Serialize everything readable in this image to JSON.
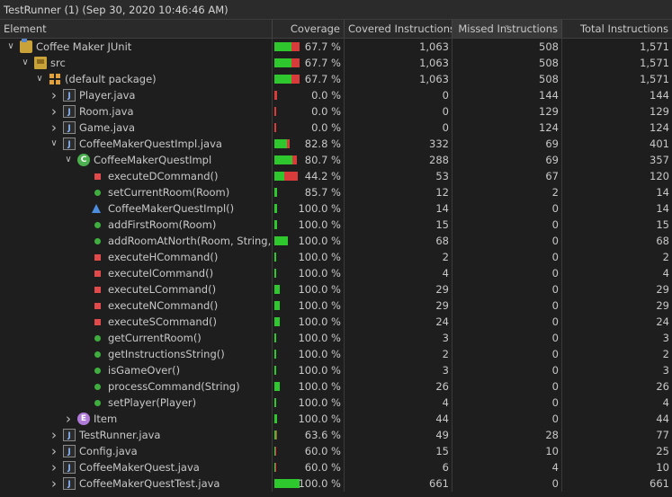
{
  "title": "TestRunner (1) (Sep 30, 2020 10:46:46 AM)",
  "columns": {
    "element": "Element",
    "coverage": "Coverage",
    "covered": "Covered Instructions",
    "missed": "Missed Instructions",
    "total": "Total Instructions"
  },
  "colors": {
    "covered": "#2ec72e",
    "missed": "#d93b3b",
    "selected": "#2d3d52"
  },
  "rows": [
    {
      "name": "Coffee Maker JUnit",
      "depth": 0,
      "twisty": "open",
      "icon": "project-icon",
      "coverage": "67.7 %",
      "covered": "1,063",
      "missed": "508",
      "total": "1,571",
      "bar_total_fraction": 1.0,
      "bar_covered_fraction": 0.677
    },
    {
      "name": "src",
      "depth": 1,
      "twisty": "open",
      "icon": "source-folder-icon",
      "coverage": "67.7 %",
      "covered": "1,063",
      "missed": "508",
      "total": "1,571",
      "bar_total_fraction": 1.0,
      "bar_covered_fraction": 0.677
    },
    {
      "name": "(default package)",
      "depth": 2,
      "twisty": "open",
      "icon": "package-icon",
      "coverage": "67.7 %",
      "covered": "1,063",
      "missed": "508",
      "total": "1,571",
      "bar_total_fraction": 1.0,
      "bar_covered_fraction": 0.677
    },
    {
      "name": "Player.java",
      "depth": 3,
      "twisty": "closed",
      "icon": "java-file-icon",
      "coverage": "0.0 %",
      "covered": "0",
      "missed": "144",
      "total": "144",
      "bar_total_fraction": 0.09,
      "bar_covered_fraction": 0.0
    },
    {
      "name": "Room.java",
      "depth": 3,
      "twisty": "closed",
      "icon": "java-file-icon",
      "coverage": "0.0 %",
      "covered": "0",
      "missed": "129",
      "total": "129",
      "bar_total_fraction": 0.08,
      "bar_covered_fraction": 0.0
    },
    {
      "name": "Game.java",
      "depth": 3,
      "twisty": "closed",
      "icon": "java-file-icon",
      "coverage": "0.0 %",
      "covered": "0",
      "missed": "124",
      "total": "124",
      "bar_total_fraction": 0.08,
      "bar_covered_fraction": 0.0
    },
    {
      "name": "CoffeeMakerQuestImpl.java",
      "depth": 3,
      "twisty": "open",
      "icon": "java-file-icon",
      "coverage": "82.8 %",
      "covered": "332",
      "missed": "69",
      "total": "401",
      "bar_total_fraction": 0.6,
      "bar_covered_fraction": 0.828
    },
    {
      "name": "CoffeeMakerQuestImpl",
      "depth": 4,
      "twisty": "open",
      "icon": "class-icon",
      "coverage": "80.7 %",
      "covered": "288",
      "missed": "69",
      "total": "357",
      "bar_total_fraction": 0.9,
      "bar_covered_fraction": 0.807
    },
    {
      "name": "executeDCommand()",
      "depth": 5,
      "twisty": "none",
      "icon": "private-method-icon",
      "coverage": "44.2 %",
      "covered": "53",
      "missed": "67",
      "total": "120",
      "bar_total_fraction": 0.92,
      "bar_covered_fraction": 0.442
    },
    {
      "name": "setCurrentRoom(Room)",
      "depth": 5,
      "twisty": "none",
      "icon": "public-method-icon",
      "coverage": "85.7 %",
      "covered": "12",
      "missed": "2",
      "total": "14",
      "bar_total_fraction": 0.1,
      "bar_covered_fraction": 0.857
    },
    {
      "name": "CoffeeMakerQuestImpl()",
      "depth": 5,
      "twisty": "none",
      "icon": "constructor-icon",
      "coverage": "100.0 %",
      "covered": "14",
      "missed": "0",
      "total": "14",
      "bar_total_fraction": 0.1,
      "bar_covered_fraction": 1.0
    },
    {
      "name": "addFirstRoom(Room)",
      "depth": 5,
      "twisty": "none",
      "icon": "public-method-icon",
      "coverage": "100.0 %",
      "covered": "15",
      "missed": "0",
      "total": "15",
      "bar_total_fraction": 0.1,
      "bar_covered_fraction": 1.0
    },
    {
      "name": "addRoomAtNorth(Room, String, S",
      "depth": 5,
      "twisty": "none",
      "icon": "public-method-icon",
      "coverage": "100.0 %",
      "covered": "68",
      "missed": "0",
      "total": "68",
      "bar_total_fraction": 0.55,
      "bar_covered_fraction": 1.0
    },
    {
      "name": "executeHCommand()",
      "depth": 5,
      "twisty": "none",
      "icon": "private-method-icon",
      "coverage": "100.0 %",
      "covered": "2",
      "missed": "0",
      "total": "2",
      "bar_total_fraction": 0.0,
      "bar_covered_fraction": 1.0
    },
    {
      "name": "executeICommand()",
      "depth": 5,
      "twisty": "none",
      "icon": "private-method-icon",
      "coverage": "100.0 %",
      "covered": "4",
      "missed": "0",
      "total": "4",
      "bar_total_fraction": 0.0,
      "bar_covered_fraction": 1.0
    },
    {
      "name": "executeLCommand()",
      "depth": 5,
      "twisty": "none",
      "icon": "private-method-icon",
      "coverage": "100.0 %",
      "covered": "29",
      "missed": "0",
      "total": "29",
      "bar_total_fraction": 0.22,
      "bar_covered_fraction": 1.0
    },
    {
      "name": "executeNCommand()",
      "depth": 5,
      "twisty": "none",
      "icon": "private-method-icon",
      "coverage": "100.0 %",
      "covered": "29",
      "missed": "0",
      "total": "29",
      "bar_total_fraction": 0.22,
      "bar_covered_fraction": 1.0
    },
    {
      "name": "executeSCommand()",
      "depth": 5,
      "twisty": "none",
      "icon": "private-method-icon",
      "coverage": "100.0 %",
      "covered": "24",
      "missed": "0",
      "total": "24",
      "bar_total_fraction": 0.2,
      "bar_covered_fraction": 1.0
    },
    {
      "name": "getCurrentRoom()",
      "depth": 5,
      "twisty": "none",
      "icon": "public-method-icon",
      "coverage": "100.0 %",
      "covered": "3",
      "missed": "0",
      "total": "3",
      "bar_total_fraction": 0.0,
      "bar_covered_fraction": 1.0
    },
    {
      "name": "getInstructionsString()",
      "depth": 5,
      "twisty": "none",
      "icon": "public-method-icon",
      "coverage": "100.0 %",
      "covered": "2",
      "missed": "0",
      "total": "2",
      "bar_total_fraction": 0.0,
      "bar_covered_fraction": 1.0
    },
    {
      "name": "isGameOver()",
      "depth": 5,
      "twisty": "none",
      "icon": "public-method-icon",
      "coverage": "100.0 %",
      "covered": "3",
      "missed": "0",
      "total": "3",
      "bar_total_fraction": 0.0,
      "bar_covered_fraction": 1.0
    },
    {
      "name": "processCommand(String)",
      "depth": 5,
      "twisty": "none",
      "icon": "public-method-icon",
      "coverage": "100.0 %",
      "covered": "26",
      "missed": "0",
      "total": "26",
      "bar_total_fraction": 0.2,
      "bar_covered_fraction": 1.0
    },
    {
      "name": "setPlayer(Player)",
      "depth": 5,
      "twisty": "none",
      "icon": "public-method-icon",
      "coverage": "100.0 %",
      "covered": "4",
      "missed": "0",
      "total": "4",
      "bar_total_fraction": 0.0,
      "bar_covered_fraction": 1.0
    },
    {
      "name": "Item",
      "depth": 4,
      "twisty": "closed",
      "icon": "enum-icon",
      "coverage": "100.0 %",
      "covered": "44",
      "missed": "0",
      "total": "44",
      "bar_total_fraction": 0.1,
      "bar_covered_fraction": 1.0
    },
    {
      "name": "TestRunner.java",
      "depth": 3,
      "twisty": "closed",
      "icon": "java-file-icon",
      "coverage": "63.6 %",
      "covered": "49",
      "missed": "28",
      "total": "77",
      "bar_total_fraction": 0.1,
      "bar_covered_fraction": 0.636
    },
    {
      "name": "Config.java",
      "depth": 3,
      "twisty": "closed",
      "icon": "java-file-icon",
      "coverage": "60.0 %",
      "covered": "15",
      "missed": "10",
      "total": "25",
      "bar_total_fraction": 0.0,
      "bar_covered_fraction": 0.6
    },
    {
      "name": "CoffeeMakerQuest.java",
      "depth": 3,
      "twisty": "closed",
      "icon": "java-file-icon",
      "coverage": "60.0 %",
      "covered": "6",
      "missed": "4",
      "total": "10",
      "bar_total_fraction": 0.0,
      "bar_covered_fraction": 0.6
    },
    {
      "name": "CoffeeMakerQuestTest.java",
      "depth": 3,
      "twisty": "closed",
      "icon": "java-file-icon",
      "coverage": "100.0 %",
      "covered": "661",
      "missed": "0",
      "total": "661",
      "bar_total_fraction": 1.0,
      "bar_covered_fraction": 1.0
    }
  ]
}
